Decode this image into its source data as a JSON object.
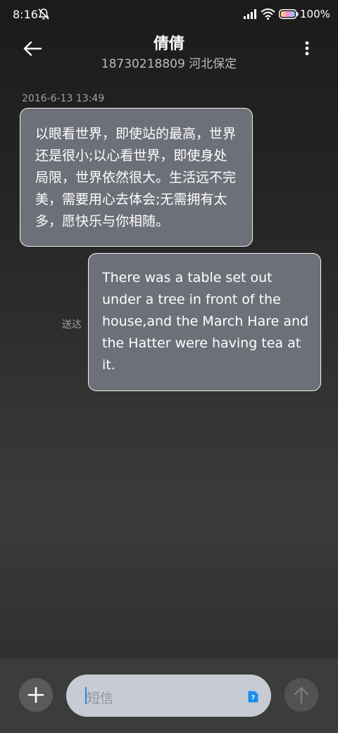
{
  "status_bar": {
    "time": "8:16",
    "battery": "100%",
    "icons": [
      "mute-bell-icon",
      "signal-icon",
      "wifi-icon",
      "battery-icon"
    ]
  },
  "header": {
    "contact_name": "倩倩",
    "contact_detail": "18730218809 河北保定",
    "back_icon": "arrow-left-icon",
    "menu_icon": "more-vertical-icon"
  },
  "conversation": {
    "timestamp": "2016-6-13 13:49",
    "received_message": "以眼看世界，即使站的最高，世界还是很小;以心看世界，即使身处局限，世界依然很大。生活远不完美，需要用心去体会;无需拥有太多，愿快乐与你相随。",
    "sent_message": "There was a table set out under a tree in front of the house,and the March Hare and the Hatter were having tea at it.",
    "sent_status": "送达"
  },
  "composer": {
    "placeholder": "短信",
    "add_icon": "plus-icon",
    "sim_icon": "sim-card-icon",
    "send_icon": "arrow-up-icon"
  },
  "colors": {
    "bubble": "#6d7078",
    "bubble_border": "#f3f3f3",
    "input_field": "#c7cbd3",
    "cursor": "#2f7df6",
    "sim_badge": "#1a8ef0"
  }
}
